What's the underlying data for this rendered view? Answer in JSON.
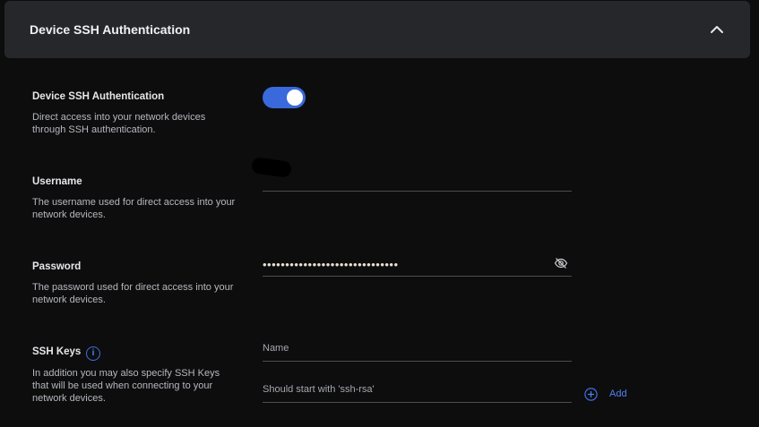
{
  "header": {
    "title": "Device SSH Authentication",
    "collapse_icon": "chevron-up-icon"
  },
  "ssh_auth": {
    "label": "Device SSH Authentication",
    "description": "Direct access into your network devices through SSH authentication.",
    "enabled": true
  },
  "username": {
    "label": "Username",
    "description": "The username used for direct access into your network devices.",
    "value": ""
  },
  "password": {
    "label": "Password",
    "description": "The password used for direct access into your network devices.",
    "masked_value": "••••••••••••••••••••••••••••••",
    "toggle_icon": "eye-off-icon"
  },
  "ssh_keys": {
    "label": "SSH Keys",
    "description": "In addition you may also specify SSH Keys that will be used when connecting to your network devices.",
    "info_icon_text": "i",
    "name_placeholder": "Name",
    "key_placeholder": "Should start with 'ssh-rsa'",
    "add_label": "Add"
  },
  "colors": {
    "accent": "#3a69db",
    "link": "#4f82f2",
    "header_bg": "#26272a",
    "page_bg": "#0d0d0e"
  }
}
